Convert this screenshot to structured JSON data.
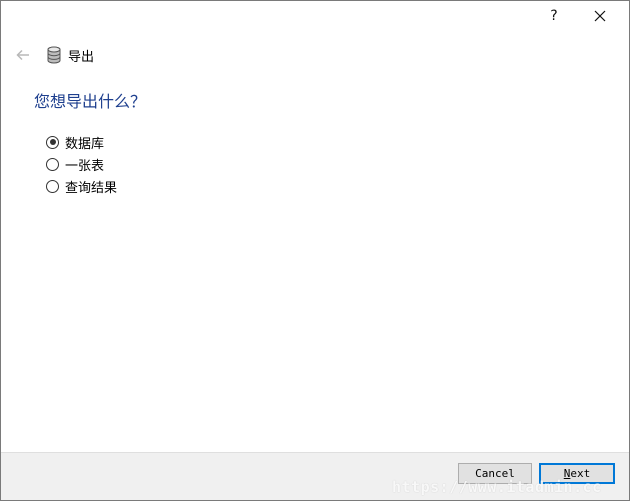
{
  "window": {
    "help_label": "?",
    "close_icon": "close-icon"
  },
  "nav": {
    "back_icon": "arrow-left-icon",
    "page_icon": "database-icon",
    "title": "导出"
  },
  "heading": "您想导出什么？",
  "options": [
    {
      "label": "数据库",
      "checked": true
    },
    {
      "label": "一张表",
      "checked": false
    },
    {
      "label": "查询结果",
      "checked": false
    }
  ],
  "footer": {
    "cancel_label": "Cancel",
    "next_label_underlined": "N",
    "next_label_rest": "ext"
  },
  "watermark": "https://www.itadmin.cc",
  "colors": {
    "heading": "#1e3f8e",
    "accent": "#0078d7",
    "footer_bg": "#f0f0f0"
  }
}
